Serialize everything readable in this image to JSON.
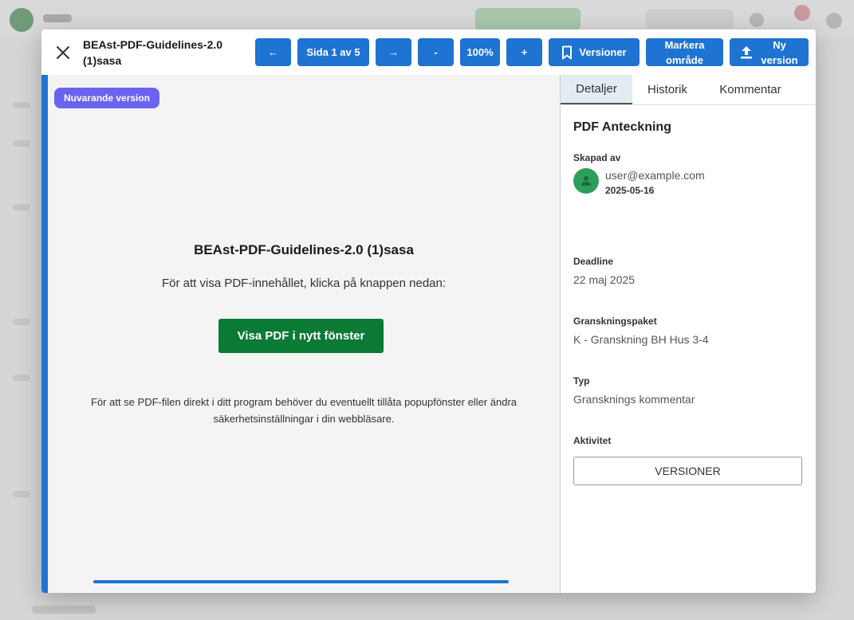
{
  "toolbar": {
    "document_title": "BEAst-PDF-Guidelines-2.0 (1)sasa",
    "prev_label": "←",
    "page_label": "Sida 1 av 5",
    "next_label": "→",
    "zoom_out_label": "-",
    "zoom_label": "100%",
    "zoom_in_label": "+",
    "versions_label": "Versioner",
    "mark_area_line1": "Markera",
    "mark_area_line2": "område",
    "new_version_line1": "Ny",
    "new_version_line2": "version"
  },
  "viewer": {
    "badge": "Nuvarande version",
    "title": "BEAst-PDF-Guidelines-2.0 (1)sasa",
    "instruction": "För att visa PDF-innehållet, klicka på knappen nedan:",
    "open_button": "Visa PDF i nytt fönster",
    "note": "För att se PDF-filen direkt i ditt program behöver du eventuellt tillåta popupfönster eller ändra säkerhetsinställningar i din webbläsare."
  },
  "sidebar": {
    "tabs": [
      "Detaljer",
      "Historik",
      "Kommentar"
    ],
    "active_tab": "Detaljer",
    "heading": "PDF Anteckning",
    "created_by_label": "Skapad av",
    "created_by_email": "user@example.com",
    "created_date": "2025-05-16",
    "deadline_label": "Deadline",
    "deadline_value": "22 maj 2025",
    "package_label": "Granskningspaket",
    "package_value": "K - Granskning BH Hus 3-4",
    "type_label": "Typ",
    "type_value": "Gransknings kommentar",
    "activity_label": "Aktivitet",
    "versions_button": "VERSIONER"
  },
  "colors": {
    "primary": "#1f73d1",
    "open_button": "#0a7a35",
    "badge": "#6b63f0",
    "avatar": "#2e9e5c"
  },
  "icons": {
    "close": "close-icon",
    "versions": "bookmark-icon",
    "new_version": "upload-icon",
    "avatar": "person-icon"
  }
}
